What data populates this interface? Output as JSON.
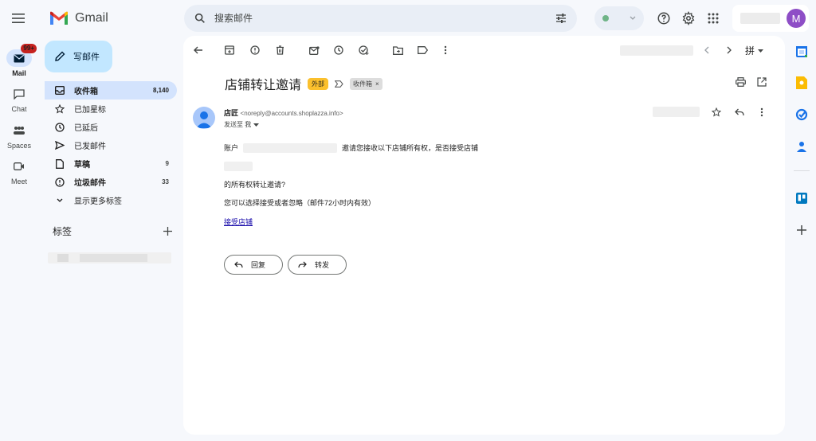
{
  "app": {
    "name": "Gmail"
  },
  "search": {
    "placeholder": "搜索邮件"
  },
  "account": {
    "initial": "M"
  },
  "rail": {
    "mail": {
      "label": "Mail",
      "badge": "99+"
    },
    "chat": {
      "label": "Chat"
    },
    "spaces": {
      "label": "Spaces"
    },
    "meet": {
      "label": "Meet"
    }
  },
  "compose": {
    "label": "写邮件"
  },
  "nav": [
    {
      "label": "收件箱",
      "count": "8,140"
    },
    {
      "label": "已加星标",
      "count": ""
    },
    {
      "label": "已延后",
      "count": ""
    },
    {
      "label": "已发邮件",
      "count": ""
    },
    {
      "label": "草稿",
      "count": "9"
    },
    {
      "label": "垃圾邮件",
      "count": "33"
    },
    {
      "label": "显示更多标签",
      "count": ""
    }
  ],
  "labels": {
    "title": "标签"
  },
  "toolbar": {
    "input_method": "拼"
  },
  "email": {
    "subject": "店铺转让邀请",
    "tag_external": "外部",
    "tag_inbox": "收件箱",
    "sender_name": "店匠",
    "sender_email": "<noreply@accounts.shoplazza.info>",
    "to_line": "发送至 我",
    "body": {
      "account_prefix": "账户",
      "invite_text": "邀请您接收以下店铺所有权，是否接受店铺",
      "ownership_line": "的所有权转让邀请?",
      "choice_line": "您可以选择接受或者忽略（邮件72小时内有效）",
      "accept_link": "接受店铺"
    },
    "reply_label": "回复",
    "forward_label": "转发"
  }
}
